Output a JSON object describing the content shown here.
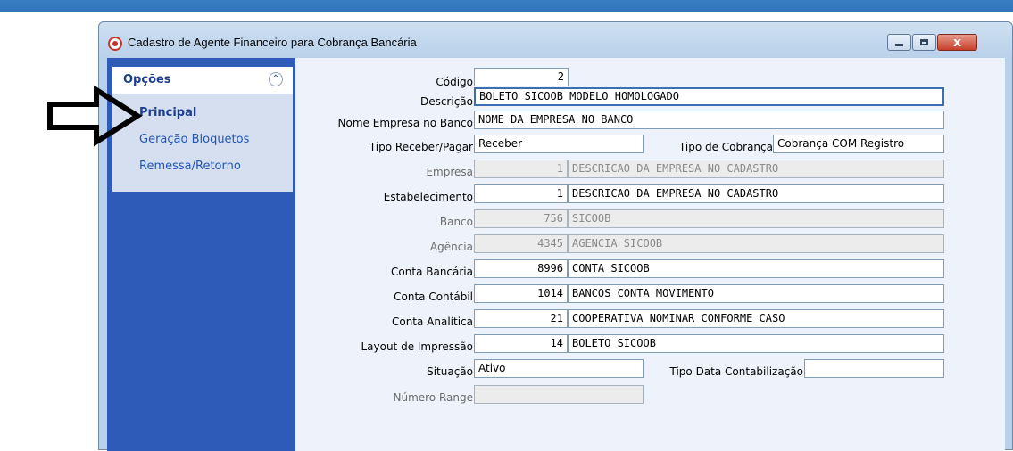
{
  "window": {
    "title": "Cadastro de Agente Financeiro para Cobrança Bancária",
    "close_glyph": "x"
  },
  "sidebar": {
    "title": "Opções",
    "collapse_glyph": "⌃",
    "items": [
      {
        "label": "Principal",
        "active": true
      },
      {
        "label": "Geração Bloquetos",
        "active": false
      },
      {
        "label": "Remessa/Retorno",
        "active": false
      }
    ]
  },
  "form": {
    "codigo": {
      "label": "Código",
      "value": "2"
    },
    "descricao": {
      "label": "Descrição",
      "value": "BOLETO SICOOB MODELO HOMOLOGADO"
    },
    "nome_empresa": {
      "label": "Nome Empresa no Banco",
      "value": "NOME DA EMPRESA NO BANCO"
    },
    "tipo_receber": {
      "label": "Tipo Receber/Pagar",
      "value": "Receber"
    },
    "tipo_cobranca": {
      "label": "Tipo de Cobrança",
      "value": "Cobrança COM Registro"
    },
    "empresa": {
      "label": "Empresa",
      "code": "1",
      "desc": "DESCRICAO DA EMPRESA NO CADASTRO"
    },
    "estabelecimento": {
      "label": "Estabelecimento",
      "code": "1",
      "desc": "DESCRICAO DA EMPRESA NO CADASTRO"
    },
    "banco": {
      "label": "Banco",
      "code": "756",
      "desc": "SICOOB"
    },
    "agencia": {
      "label": "Agência",
      "code": "4345",
      "desc": "AGENCIA SICOOB"
    },
    "conta_bancaria": {
      "label": "Conta Bancária",
      "code": "8996",
      "desc": "CONTA SICOOB"
    },
    "conta_contabil": {
      "label": "Conta Contábil",
      "code": "1014",
      "desc": "BANCOS CONTA MOVIMENTO"
    },
    "conta_analitica": {
      "label": "Conta Analítica",
      "code": "21",
      "desc": "COOPERATIVA NOMINAR CONFORME CASO"
    },
    "layout_impressao": {
      "label": "Layout de Impressão",
      "code": "14",
      "desc": "BOLETO SICOOB"
    },
    "situacao": {
      "label": "Situação",
      "value": "Ativo"
    },
    "tipo_data": {
      "label": "Tipo Data Contabilização",
      "value": ""
    },
    "numero_range": {
      "label": "Número Range",
      "value": ""
    }
  },
  "colors": {
    "sidebar_bg": "#2f5bb8",
    "client_bg": "#eef2fb",
    "accent_text": "#1b3f8f"
  },
  "icons": {
    "app": "app-record-icon",
    "pointer": "pointing-arrow-icon"
  }
}
